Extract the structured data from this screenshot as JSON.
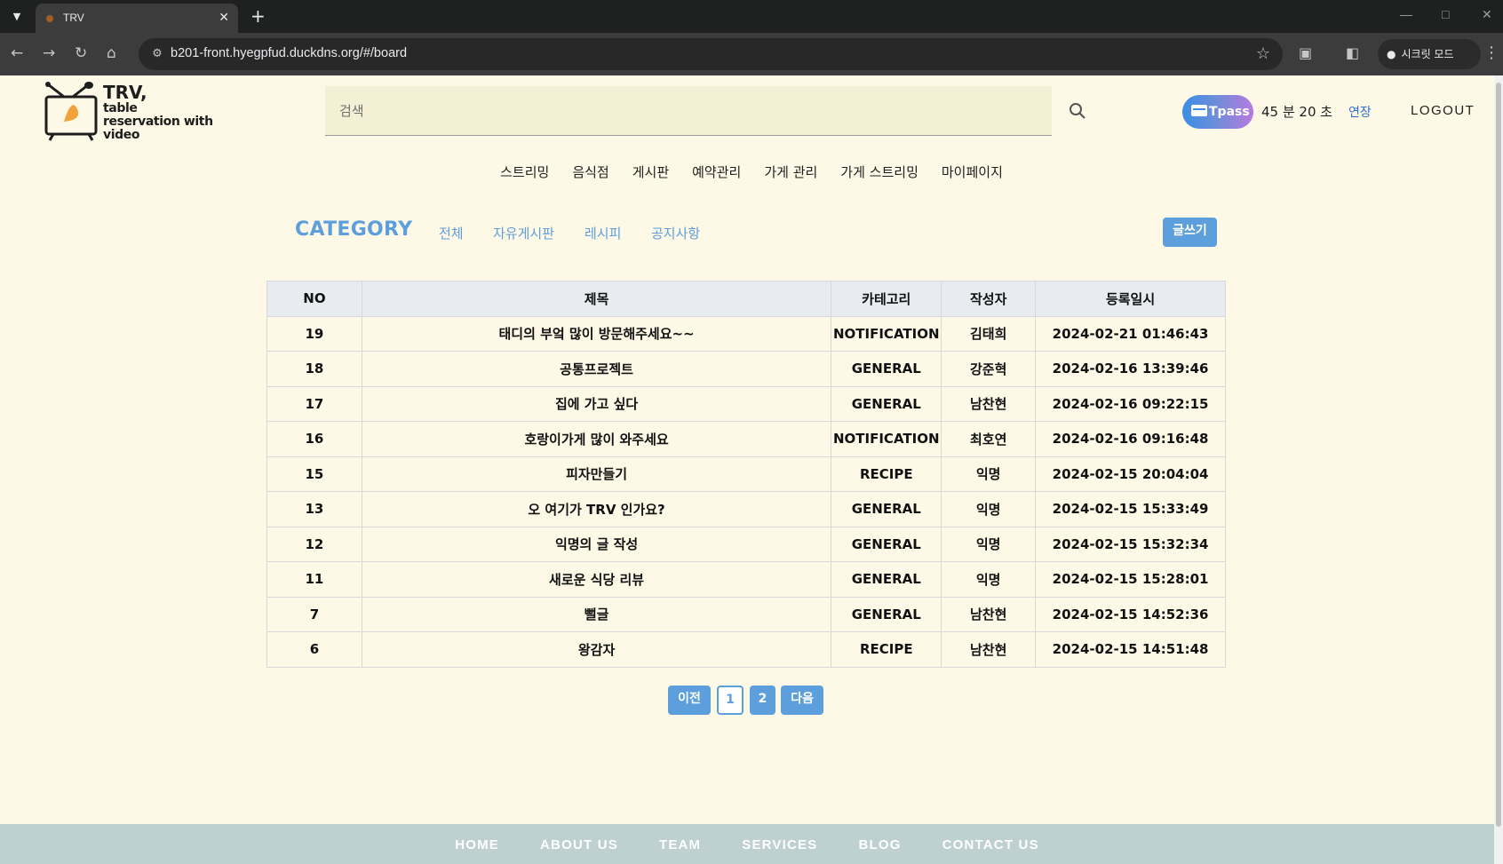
{
  "browser": {
    "tab_title": "TRV",
    "url": "b201-front.hyegpfud.duckdns.org/#/board",
    "incognito_label": "시크릿 모드"
  },
  "header": {
    "logo_title": "TRV,",
    "logo_line2": "table",
    "logo_line3": "reservation with",
    "logo_line4": "video",
    "search_placeholder": "검색",
    "tpass_label": "Tpass",
    "timer": "45 분 20 초",
    "extend_label": "연장",
    "logout_label": "LOGOUT"
  },
  "nav": {
    "items": [
      "스트리밍",
      "음식점",
      "게시판",
      "예약관리",
      "가게 관리",
      "가게 스트리밍",
      "마이페이지"
    ]
  },
  "board": {
    "category_title": "CATEGORY",
    "categories": [
      "전체",
      "자유게시판",
      "레시피",
      "공지사항"
    ],
    "write_label": "글쓰기",
    "columns": [
      "NO",
      "제목",
      "카테고리",
      "작성자",
      "등록일시"
    ],
    "rows": [
      {
        "no": "19",
        "title": "태디의 부엌 많이 방문해주세요~~",
        "category": "NOTIFICATION",
        "author": "김태희",
        "date": "2024-02-21 01:46:43"
      },
      {
        "no": "18",
        "title": "공통프로젝트",
        "category": "GENERAL",
        "author": "강준혁",
        "date": "2024-02-16 13:39:46"
      },
      {
        "no": "17",
        "title": "집에 가고 싶다",
        "category": "GENERAL",
        "author": "남찬현",
        "date": "2024-02-16 09:22:15"
      },
      {
        "no": "16",
        "title": "호랑이가게 많이 와주세요",
        "category": "NOTIFICATION",
        "author": "최호연",
        "date": "2024-02-16 09:16:48"
      },
      {
        "no": "15",
        "title": "피자만들기",
        "category": "RECIPE",
        "author": "익명",
        "date": "2024-02-15 20:04:04"
      },
      {
        "no": "13",
        "title": "오 여기가 TRV 인가요?",
        "category": "GENERAL",
        "author": "익명",
        "date": "2024-02-15 15:33:49"
      },
      {
        "no": "12",
        "title": "익명의 글 작성",
        "category": "GENERAL",
        "author": "익명",
        "date": "2024-02-15 15:32:34"
      },
      {
        "no": "11",
        "title": "새로운 식당 리뷰",
        "category": "GENERAL",
        "author": "익명",
        "date": "2024-02-15 15:28:01"
      },
      {
        "no": "7",
        "title": "뻘글",
        "category": "GENERAL",
        "author": "남찬현",
        "date": "2024-02-15 14:52:36"
      },
      {
        "no": "6",
        "title": "왕감자",
        "category": "RECIPE",
        "author": "남찬현",
        "date": "2024-02-15 14:51:48"
      }
    ]
  },
  "pagination": {
    "prev_label": "이전",
    "pages": [
      "1",
      "2"
    ],
    "active_page": "1",
    "next_label": "다음"
  },
  "footer": {
    "links": [
      "HOME",
      "ABOUT US",
      "TEAM",
      "SERVICES",
      "BLOG",
      "CONTACT US"
    ]
  },
  "colors": {
    "page_bg": "#fdf9e6",
    "accent": "#5d9fdc",
    "footer_bg": "#bfd0d0"
  }
}
